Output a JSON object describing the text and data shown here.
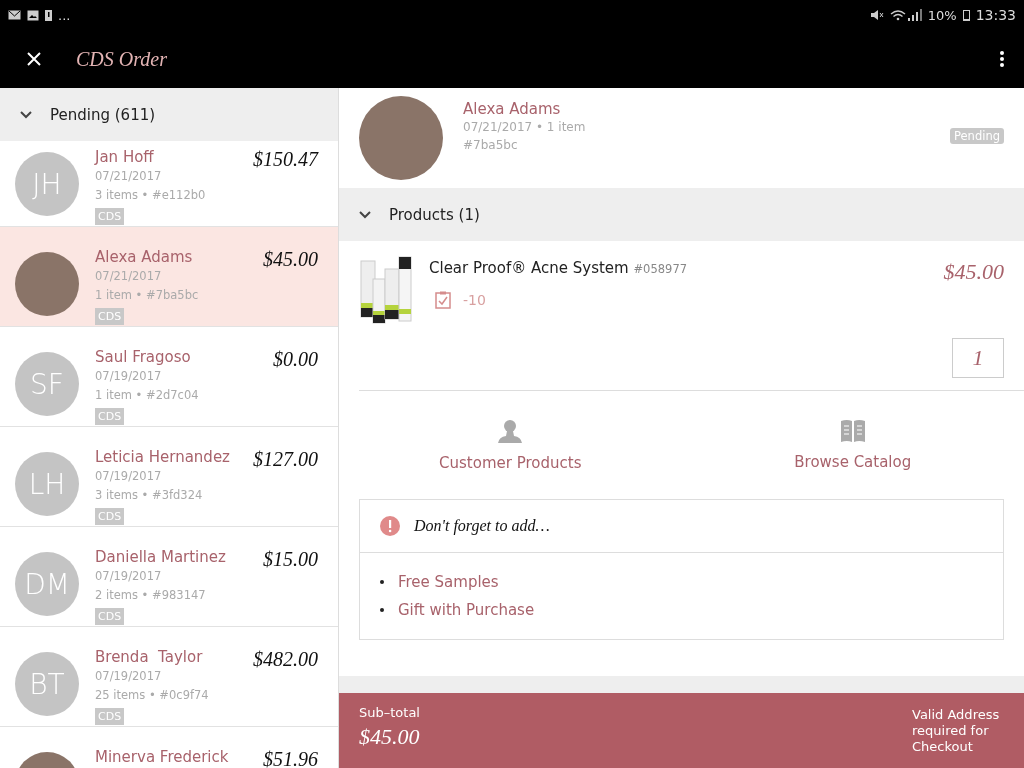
{
  "status_bar": {
    "notification_more": "...",
    "battery_percent": "10%",
    "time": "13:33"
  },
  "app_bar": {
    "title": "CDS Order"
  },
  "order_list": {
    "group_label": "Pending (611)",
    "expanded": true,
    "orders": [
      {
        "kind": "initials",
        "initials": "JH",
        "name": "Jan Hoff",
        "date": "07/21/2017",
        "summary": "3 items • #e112b0",
        "tag": "CDS",
        "total": "$150.47",
        "selected": false
      },
      {
        "kind": "photo",
        "name": "Alexa Adams",
        "date": "07/21/2017",
        "summary": "1 item • #7ba5bc",
        "tag": "CDS",
        "total": "$45.00",
        "selected": true
      },
      {
        "kind": "initials",
        "initials": "SF",
        "name": "Saul Fragoso",
        "date": "07/19/2017",
        "summary": "1 item • #2d7c04",
        "tag": "CDS",
        "total": "$0.00",
        "selected": false
      },
      {
        "kind": "initials",
        "initials": "LH",
        "name": "Leticia Hernandez",
        "date": "07/19/2017",
        "summary": "3 items • #3fd324",
        "tag": "CDS",
        "total": "$127.00",
        "selected": false
      },
      {
        "kind": "initials",
        "initials": "DM",
        "name": "Daniella Martinez",
        "date": "07/19/2017",
        "summary": "2 items • #983147",
        "tag": "CDS",
        "total": "$15.00",
        "selected": false
      },
      {
        "kind": "initials",
        "initials": "BT",
        "name": "Brenda  Taylor",
        "date": "07/19/2017",
        "summary": "25 items • #0c9f74",
        "tag": "CDS",
        "total": "$482.00",
        "selected": false
      },
      {
        "kind": "photo",
        "name": "Minerva Frederick",
        "total": "$51.96",
        "selected": false
      }
    ]
  },
  "order_detail": {
    "customer_name": "Alexa Adams",
    "summary": "07/21/2017 • 1 item",
    "id": "#7ba5bc",
    "status": "Pending",
    "products_label": "Products (1)",
    "products_expanded": true,
    "products": [
      {
        "name": "Clear Proof® Acne System",
        "sku": "#058977",
        "points": "-10",
        "price": "$45.00",
        "quantity": "1"
      }
    ],
    "actions": [
      {
        "kind": "person",
        "label": "Customer Products"
      },
      {
        "kind": "book",
        "label": "Browse Catalog"
      }
    ],
    "reminder": {
      "title": "Don't forget to add…",
      "links": [
        "Free Samples",
        "Gift with Purchase"
      ]
    },
    "footer": {
      "subtotal_label": "Sub–total",
      "subtotal": "$45.00",
      "notice": "Valid Address required for Checkout"
    }
  }
}
